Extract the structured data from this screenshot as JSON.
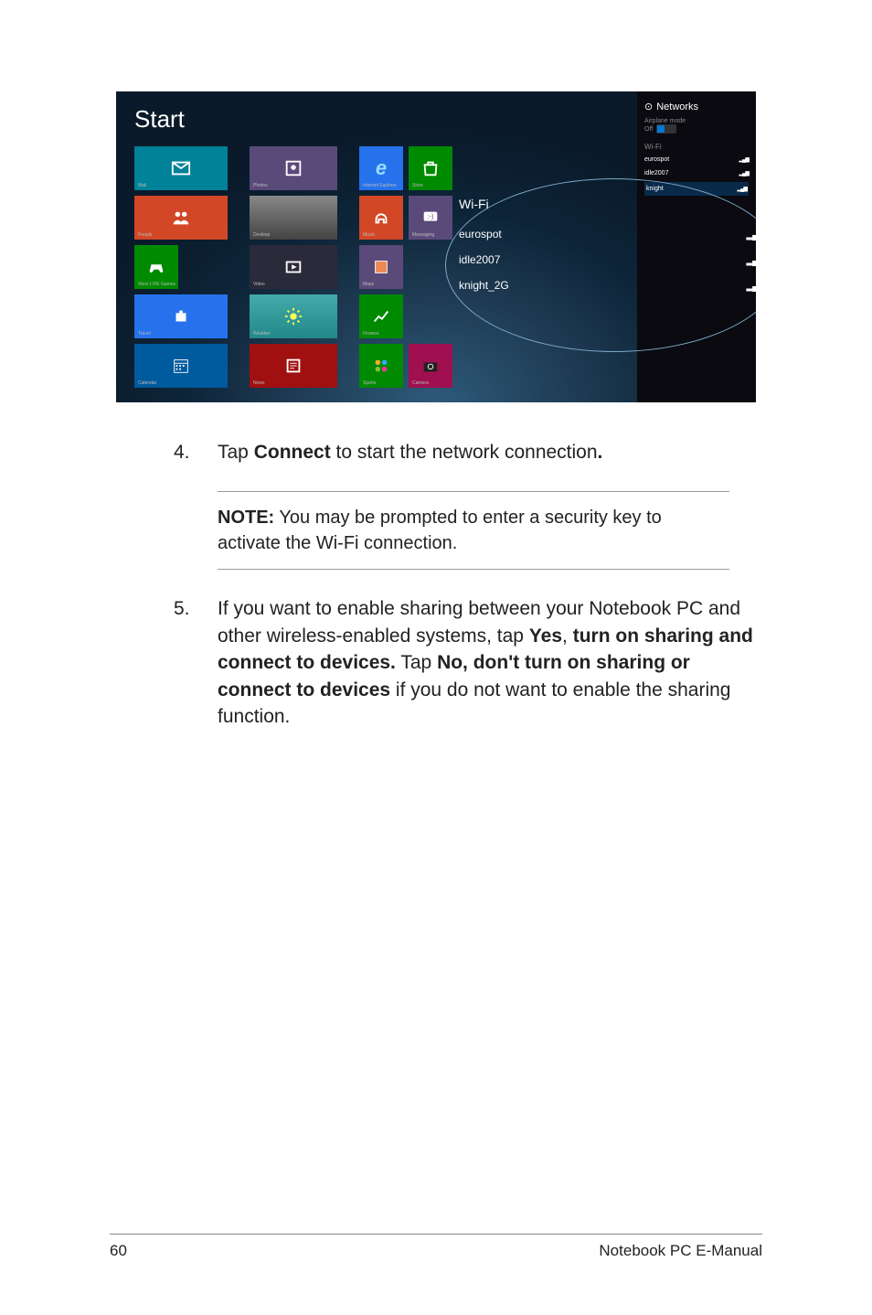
{
  "screenshot": {
    "start_label": "Start",
    "networks": {
      "header": "Networks",
      "airplane_label": "Airplane mode",
      "airplane_state": "Off",
      "wifi_section": "Wi-Fi",
      "list": [
        {
          "name": "eurospot"
        },
        {
          "name": "idle2007"
        },
        {
          "name": "knight"
        }
      ]
    },
    "callout": {
      "title": "Wi-Fi",
      "items": [
        {
          "name": "eurospot"
        },
        {
          "name": "idle2007"
        },
        {
          "name": "knight_2G"
        }
      ]
    },
    "tiles": {
      "mail": "Mail",
      "photos": "Photos",
      "ie": "Internet Explorer",
      "store": "Store",
      "people": "People",
      "desktop": "Desktop",
      "music": "Music",
      "messaging": "Messaging",
      "xbox": "Xbox LIVE Games",
      "video": "Video",
      "maps": "Maps",
      "travel": "Travel",
      "weather": "Weather",
      "finance": "Finance",
      "calendar": "Calendar",
      "news": "News",
      "sports": "Sports",
      "camera": "Camera"
    }
  },
  "step4": {
    "num": "4.",
    "pre": "Tap ",
    "bold": "Connect",
    "post": " to start the network connection",
    "period": "."
  },
  "note": {
    "label": "NOTE:",
    "text": " You may be prompted to enter a security key to activate the Wi-Fi connection."
  },
  "step5": {
    "num": "5.",
    "t1": "If you want to enable sharing between your Notebook PC and other wireless-enabled systems, tap ",
    "b1": "Yes",
    "t2": ", ",
    "b2": "turn on sharing and connect to devices.",
    "t3": " Tap ",
    "b3": "No, don't turn on sharing or connect to devices",
    "t4": " if you do not want to enable the sharing function."
  },
  "footer": {
    "page": "60",
    "title": "Notebook PC E-Manual"
  }
}
